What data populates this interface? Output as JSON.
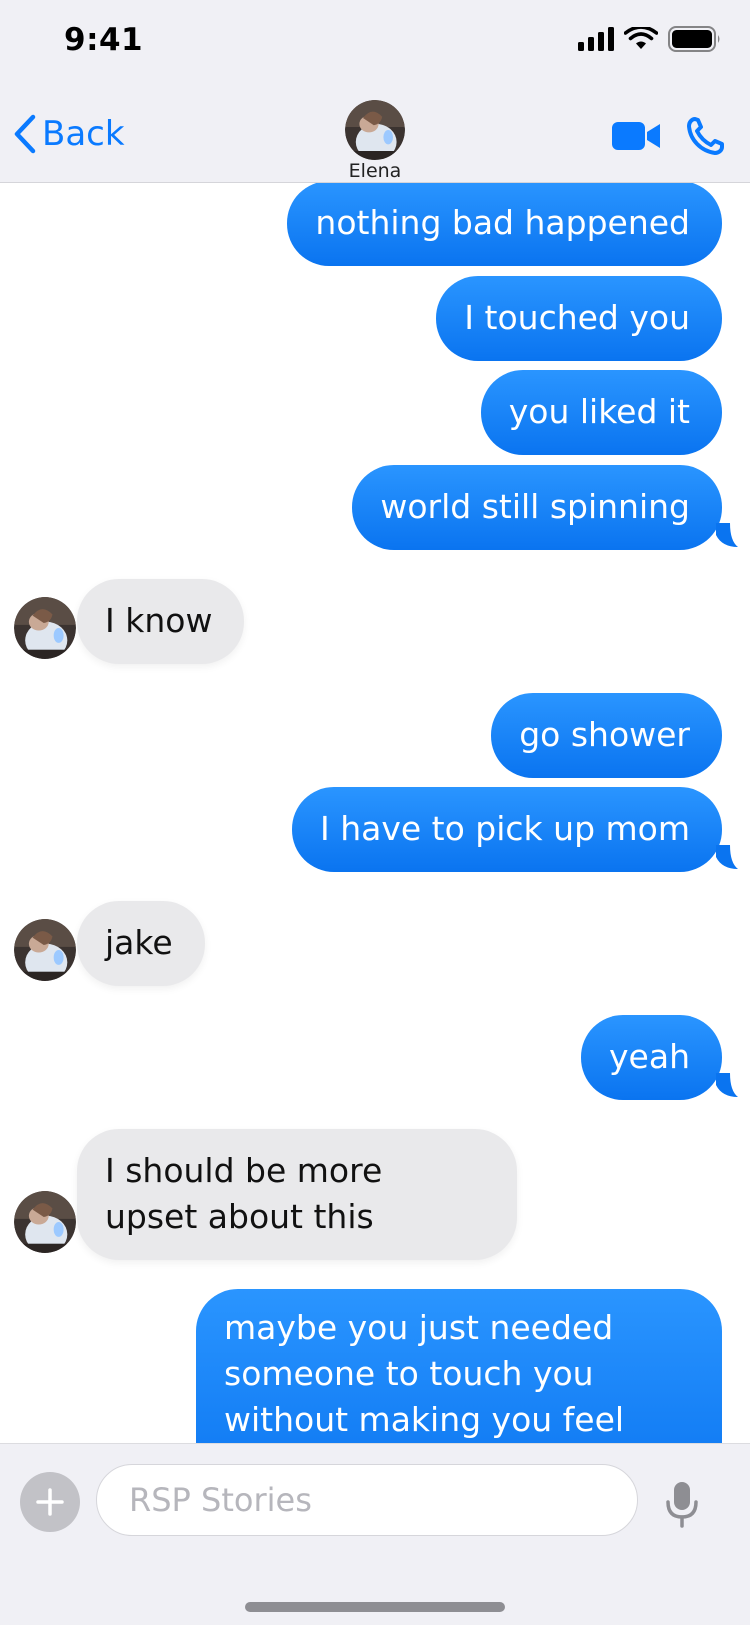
{
  "status_bar": {
    "time": "9:41",
    "icons": [
      "signal-icon",
      "wifi-icon",
      "battery-icon"
    ]
  },
  "nav": {
    "back_label": "Back",
    "contact_name": "Elena",
    "actions": [
      "video-call-icon",
      "phone-icon"
    ]
  },
  "colors": {
    "accent": "#0a7aff",
    "outgoing_bubble": "#1483f8",
    "incoming_bubble": "#e9e9eb",
    "background": "#f0f0f5"
  },
  "messages": [
    {
      "from": "me",
      "text": "nothing bad happened"
    },
    {
      "from": "me",
      "text": "I touched you"
    },
    {
      "from": "me",
      "text": "you liked it"
    },
    {
      "from": "me",
      "text": "world still spinning"
    },
    {
      "from": "them",
      "text": "I know"
    },
    {
      "from": "me",
      "text": "go shower"
    },
    {
      "from": "me",
      "text": "I have to pick up mom"
    },
    {
      "from": "them",
      "text": "jake"
    },
    {
      "from": "me",
      "text": "yeah"
    },
    {
      "from": "them",
      "text": "I should be more upset about this"
    },
    {
      "from": "me",
      "text": "maybe you just needed someone to touch you without making you feel bad"
    }
  ],
  "composer": {
    "placeholder": "RSP Stories",
    "add_icon": "plus-icon",
    "mic_icon": "microphone-icon"
  }
}
